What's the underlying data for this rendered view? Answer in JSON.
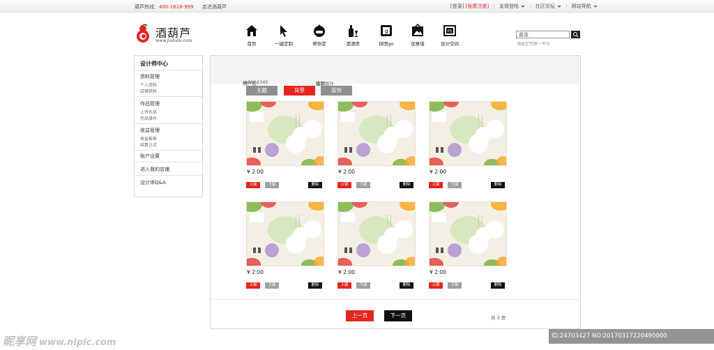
{
  "topbar": {
    "hotline_label": "葫芦热线：",
    "hotline_number": "400-1618-999",
    "about": "走进酒葫芦",
    "login": "[登录]",
    "register": "[免费注册]",
    "links": "友情登陆",
    "forum": "社区论坛",
    "site_nav": "网站导航"
  },
  "brand": {
    "name": "酒葫芦",
    "url": "www.jiuhulu.com"
  },
  "nav": [
    {
      "label": "首页",
      "icon": "home-icon"
    },
    {
      "label": "一键定制",
      "icon": "cursor-icon"
    },
    {
      "label": "帮你定",
      "icon": "headset-icon"
    },
    {
      "label": "酒酒馆",
      "icon": "bottle-icon"
    },
    {
      "label": "拼团go",
      "icon": "group-icon"
    },
    {
      "label": "创意墙",
      "icon": "picture-icon"
    },
    {
      "label": "设计空间",
      "icon": "frame-icon"
    }
  ],
  "search": {
    "value": "酱香",
    "hint": "酒类定制第一平台"
  },
  "sidebar": {
    "title": "设计师中心",
    "groups": [
      {
        "label": "资料管理",
        "subs": [
          "个人资料",
          "店铺资料"
        ]
      },
      {
        "label": "作品管理",
        "subs": [
          "上传作品",
          "作品操作"
        ]
      },
      {
        "label": "收益管理",
        "subs": [
          "收益报表",
          "结算方式"
        ]
      }
    ],
    "links": [
      "账户设置",
      "进入我的店铺",
      "设计师Q&A"
    ]
  },
  "profile": {
    "username_label": "用户名：",
    "username": "zb0902345",
    "level_label": "级别：",
    "level": "金牌设计"
  },
  "tabs": [
    "主题",
    "背景",
    "装饰"
  ],
  "active_tab": 1,
  "products": [
    {
      "price": "¥ 2:00"
    },
    {
      "price": "¥ 2:00"
    },
    {
      "price": "¥ 2:00"
    },
    {
      "price": "¥ 2:00"
    },
    {
      "price": "¥ 2:00"
    },
    {
      "price": "¥ 2:00"
    }
  ],
  "actions": {
    "up": "上架",
    "down": "下架",
    "delete": "删除"
  },
  "pager": {
    "prev": "上一页",
    "next": "下一页",
    "info": "共 3 页"
  },
  "watermark": {
    "site": "昵享网",
    "url": "www.nipic.com",
    "id": "ID:24703427 NO:20170317220490000"
  },
  "colors": {
    "accent": "#e3261e",
    "dark": "#111111",
    "grey_tab": "#8f8f8f"
  }
}
